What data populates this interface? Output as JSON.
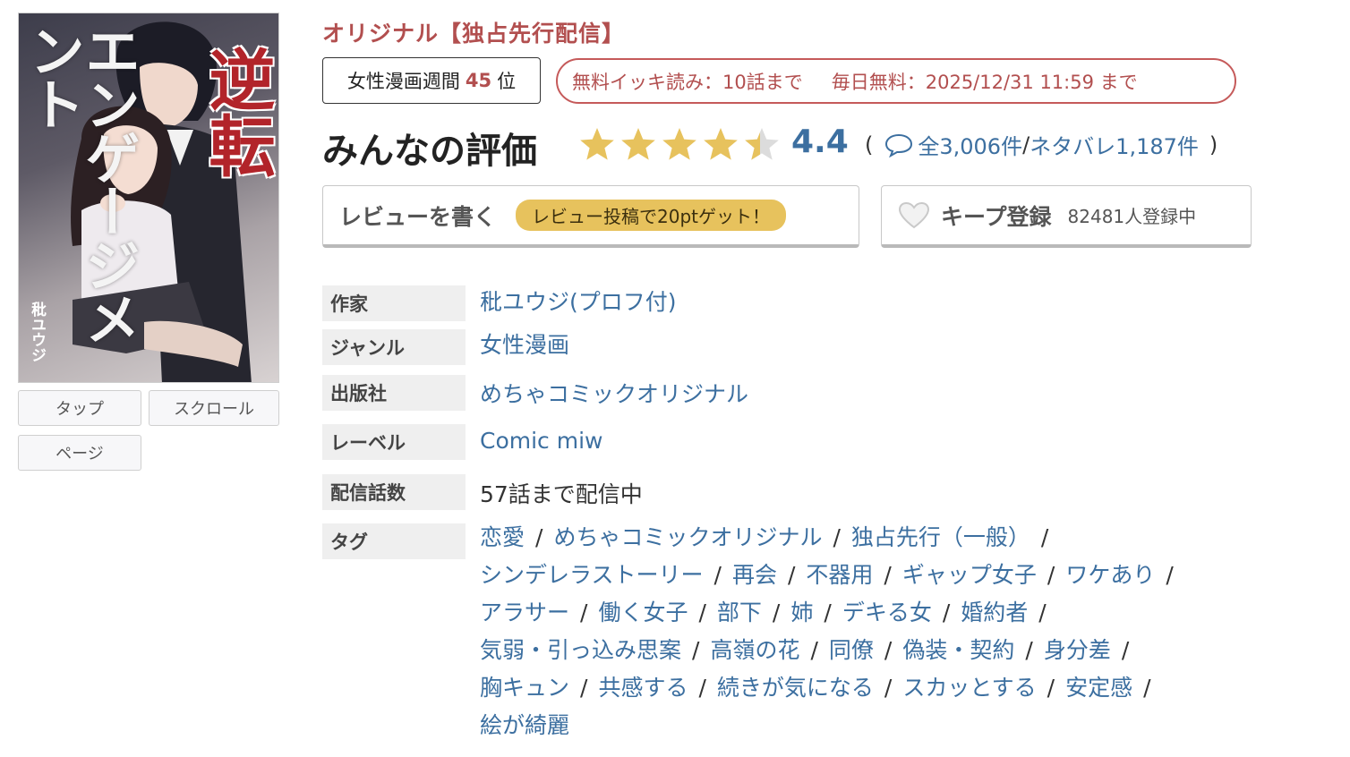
{
  "cover": {
    "title": "逆転",
    "title_sub": "エンゲージメント",
    "author": "秕ユウジ"
  },
  "viewer_buttons": {
    "tap": "タップ",
    "scroll": "スクロール",
    "page": "ページ"
  },
  "label_original": "オリジナル【独占先行配信】",
  "ranking": {
    "prefix": "女性漫画週間",
    "rank": "45",
    "suffix": "位"
  },
  "free_info": {
    "ikki": "無料イッキ読み：10話まで",
    "daily": "毎日無料：2025/12/31 11:59 まで"
  },
  "evaluation": {
    "title": "みんなの評価",
    "rating_value": 4.4,
    "score": "4.4",
    "open_paren": "(",
    "reviews": "全3,006件",
    "separator": "/",
    "spoilers": "ネタバレ1,187件",
    "close_paren": ")"
  },
  "review_button": {
    "label": "レビューを書く",
    "bonus": "レビュー投稿で20ptゲット！"
  },
  "keep_button": {
    "label": "キープ登録",
    "count": "82481人登録中"
  },
  "info": {
    "author_label": "作家",
    "author_value": "秕ユウジ(プロフ付)",
    "genre_label": "ジャンル",
    "genre_value": "女性漫画",
    "publisher_label": "出版社",
    "publisher_value": "めちゃコミックオリジナル",
    "label_label": "レーベル",
    "label_value": "Comic miw",
    "episodes_label": "配信話数",
    "episodes_value": "57話まで配信中",
    "tags_label": "タグ"
  },
  "tag_separator": "/",
  "tags": [
    [
      "恋愛",
      "めちゃコミックオリジナル",
      "独占先行（一般）"
    ],
    [
      "シンデレラストーリー",
      "再会",
      "不器用",
      "ギャップ女子",
      "ワケあり"
    ],
    [
      "アラサー",
      "働く女子",
      "部下",
      "姉",
      "デキる女",
      "婚約者"
    ],
    [
      "気弱・引っ込み思案",
      "高嶺の花",
      "同僚",
      "偽装・契約",
      "身分差"
    ],
    [
      "胸キュン",
      "共感する",
      "続きが気になる",
      "スカッとする",
      "安定感"
    ],
    [
      "絵が綺麗"
    ]
  ],
  "colors": {
    "accent_red": "#b24f4f",
    "link_blue": "#3c6fa0",
    "star_gold": "#e7c25d",
    "star_empty": "#dcdcdc"
  }
}
